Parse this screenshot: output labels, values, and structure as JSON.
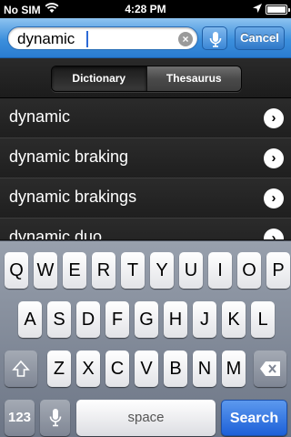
{
  "status_bar": {
    "carrier": "No SIM",
    "time": "4:28 PM"
  },
  "search": {
    "value": "dynamic",
    "cancel_label": "Cancel"
  },
  "segments": {
    "dictionary_label": "Dictionary",
    "thesaurus_label": "Thesaurus",
    "selected": "Dictionary"
  },
  "results": [
    {
      "label": "dynamic"
    },
    {
      "label": "dynamic braking"
    },
    {
      "label": "dynamic brakings"
    },
    {
      "label": "dynamic duo"
    }
  ],
  "keyboard": {
    "row1": [
      "Q",
      "W",
      "E",
      "R",
      "T",
      "Y",
      "U",
      "I",
      "O",
      "P"
    ],
    "row2": [
      "A",
      "S",
      "D",
      "F",
      "G",
      "H",
      "J",
      "K",
      "L"
    ],
    "row3": [
      "Z",
      "X",
      "C",
      "V",
      "B",
      "N",
      "M"
    ],
    "numbers_label": "123",
    "space_label": "space",
    "search_label": "Search"
  },
  "colors": {
    "accent": "#2a7cd0",
    "search_key": "#1d60d8"
  },
  "icons": {
    "wifi": "wifi-icon",
    "location": "location-arrow-icon",
    "battery": "battery-icon",
    "clear": "clear-circle-icon",
    "mic": "microphone-icon",
    "disclosure": "chevron-right-circle-icon",
    "shift": "shift-arrow-icon",
    "delete": "backspace-icon"
  }
}
